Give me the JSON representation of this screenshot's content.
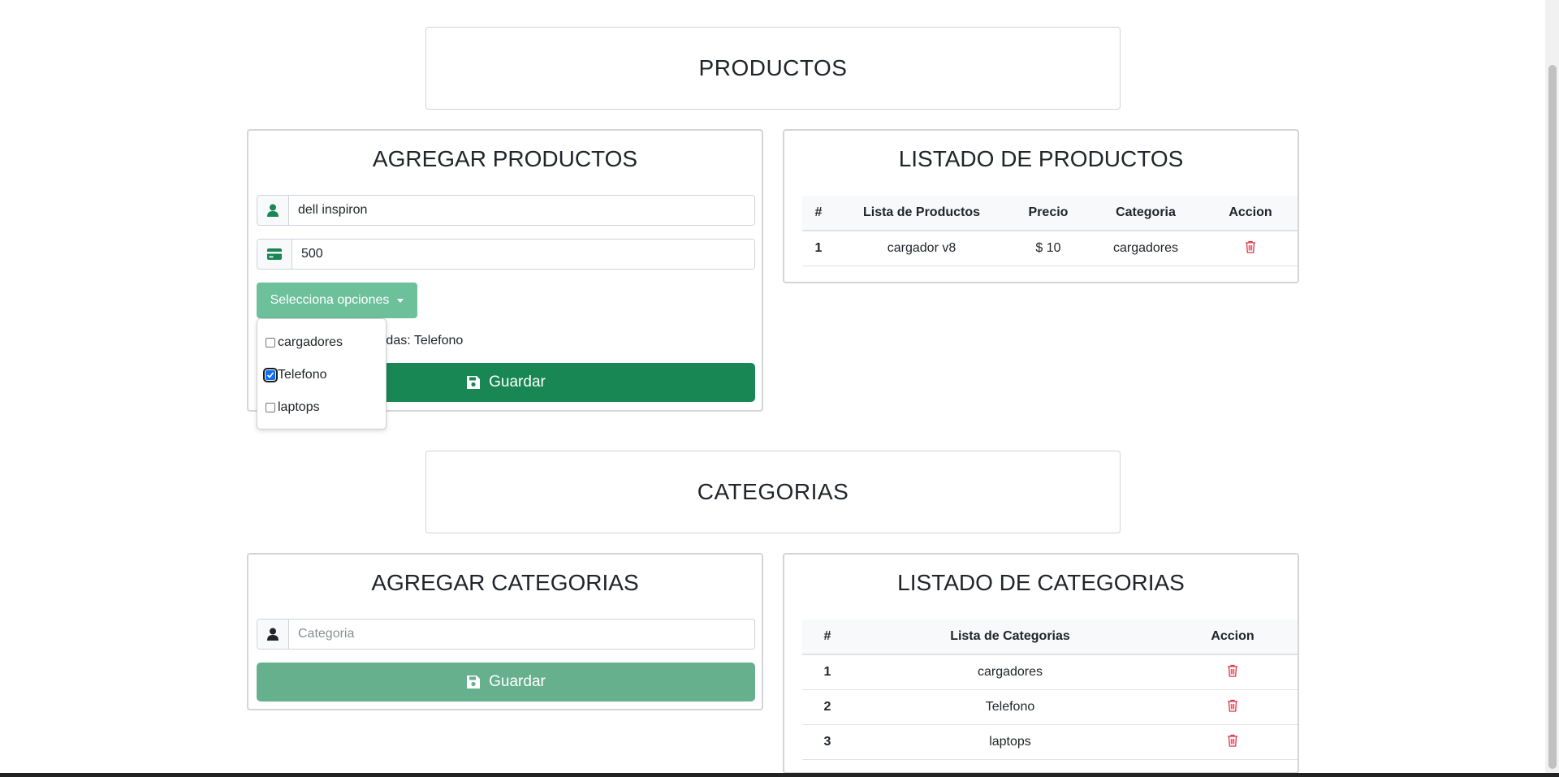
{
  "productos_section": {
    "title": "PRODUCTOS"
  },
  "agregar_productos": {
    "title": "AGREGAR PRODUCTOS",
    "name_value": "dell inspiron",
    "price_value": "500",
    "dropdown_label": "Selecciona opciones",
    "selected_text": "Categorias seleccionadas: Telefono",
    "options": [
      {
        "label": "cargadores",
        "checked": false
      },
      {
        "label": "Telefono",
        "checked": true
      },
      {
        "label": "laptops",
        "checked": false
      }
    ],
    "save_label": "Guardar"
  },
  "listado_productos": {
    "title": "LISTADO DE PRODUCTOS",
    "headers": [
      "#",
      "Lista de Productos",
      "Precio",
      "Categoria",
      "Accion"
    ],
    "rows": [
      {
        "idx": "1",
        "name": "cargador v8",
        "price": "$ 10",
        "category": "cargadores"
      }
    ]
  },
  "categorias_section": {
    "title": "CATEGORIAS"
  },
  "agregar_categorias": {
    "title": "AGREGAR CATEGORIAS",
    "input_placeholder": "Categoria",
    "save_label": "Guardar"
  },
  "listado_categorias": {
    "title": "LISTADO DE CATEGORIAS",
    "headers": [
      "#",
      "Lista de Categorias",
      "Accion"
    ],
    "rows": [
      {
        "idx": "1",
        "name": "cargadores"
      },
      {
        "idx": "2",
        "name": "Telefono"
      },
      {
        "idx": "3",
        "name": "laptops"
      }
    ]
  },
  "icons": {
    "user": "user-icon",
    "card": "credit-card-icon",
    "save": "floppy-disk-icon",
    "delete": "trash-icon"
  },
  "colors": {
    "primary_green": "#198754",
    "light_green": "#6cc09a",
    "danger": "#dc3545",
    "checkbox_blue": "#0d6efd"
  }
}
